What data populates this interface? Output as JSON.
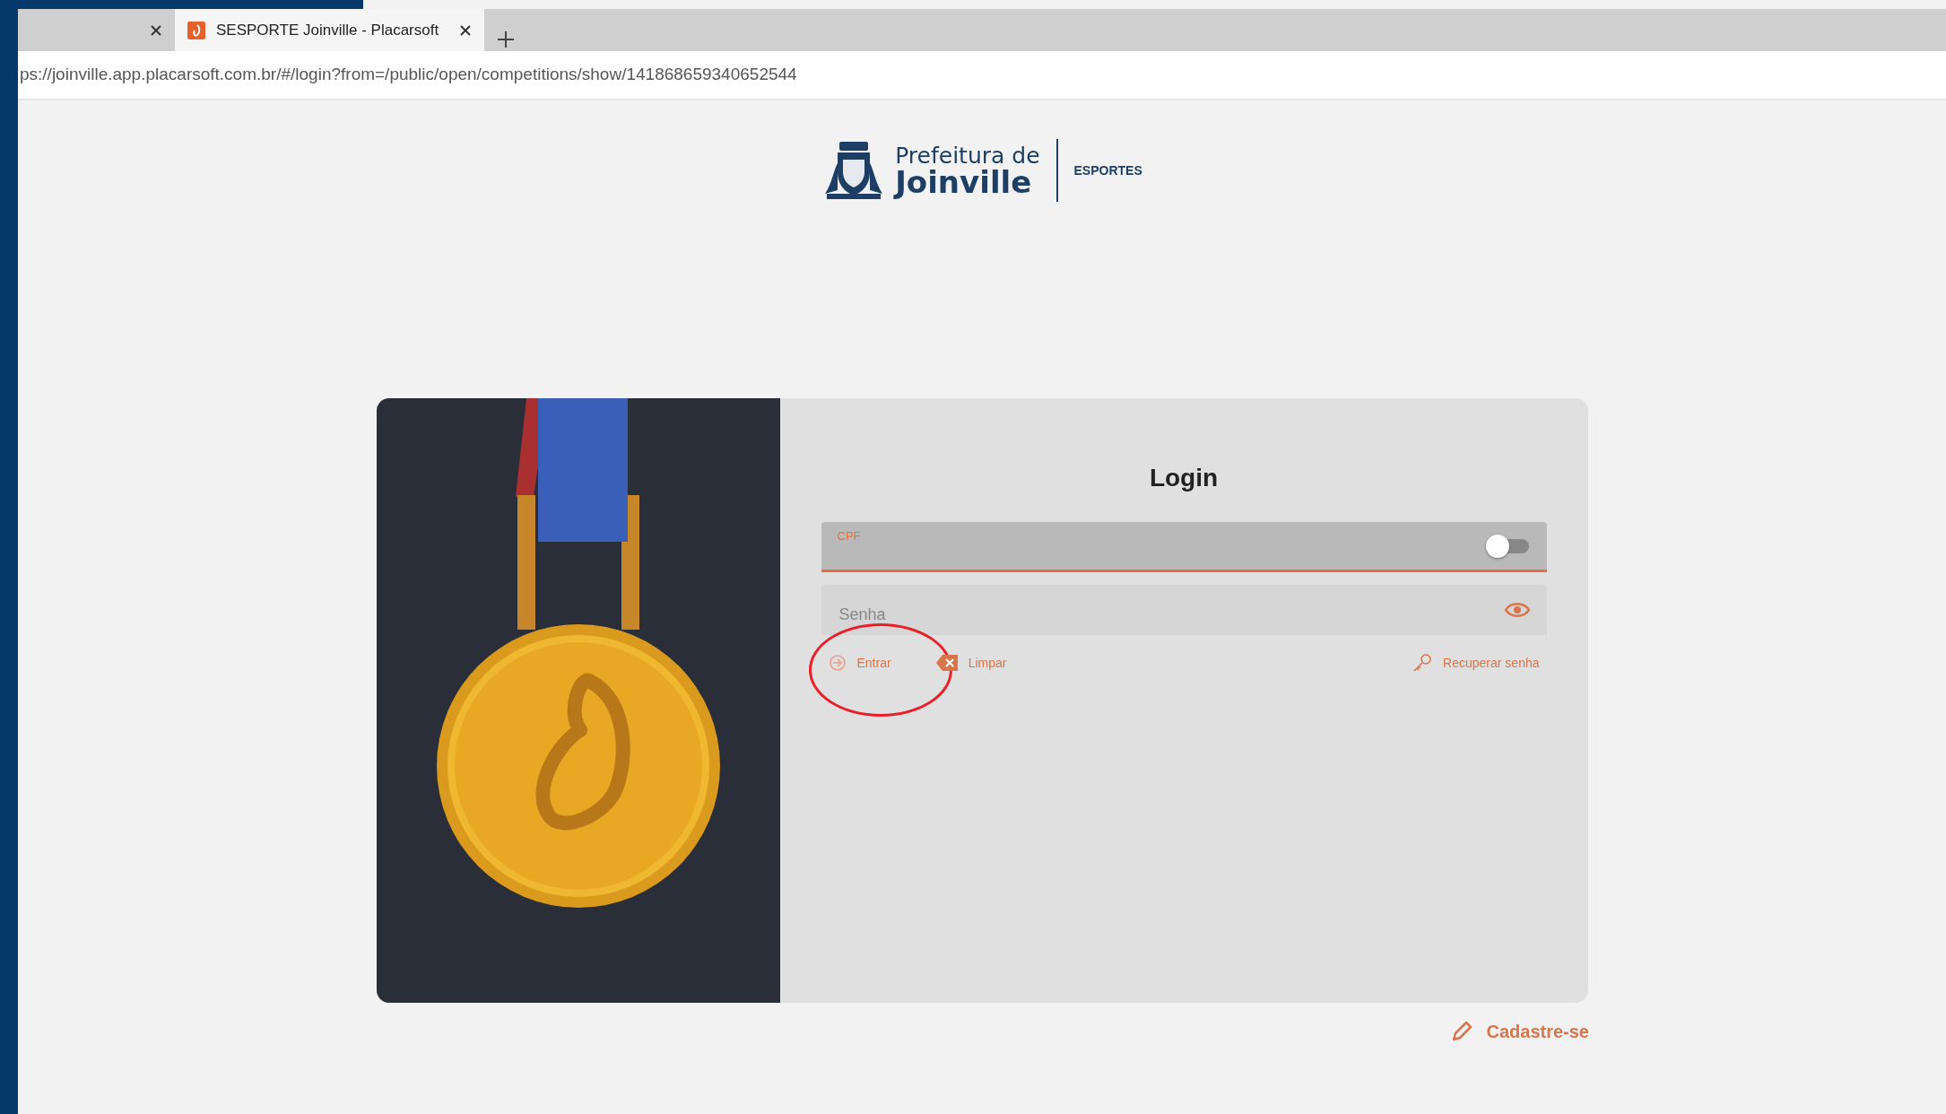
{
  "browser": {
    "tabs": [
      {
        "selected": false
      },
      {
        "title": "SESPORTE Joinville - Placarsoft",
        "selected": true
      }
    ],
    "url": "ps://joinville.app.placarsoft.com.br/#/login?from=/public/open/competitions/show/141868659340652544"
  },
  "logo": {
    "line_1": "Prefeitura de",
    "line_2": "Joinville",
    "department": "ESPORTES"
  },
  "login": {
    "title": "Login",
    "fields": [
      {
        "kind": "text",
        "label": "CPF",
        "focused": true,
        "toggle_on": false
      },
      {
        "kind": "password",
        "placeholder": "Senha",
        "focused": false
      }
    ],
    "actions": [
      {
        "kind": "enter",
        "label": "Entrar",
        "annotated": true
      },
      {
        "kind": "clear",
        "label": "Limpar",
        "annotated": false
      },
      {
        "kind": "recover",
        "label": "Recuperar senha",
        "annotated": false
      }
    ]
  },
  "register_link": "Cadastre-se"
}
